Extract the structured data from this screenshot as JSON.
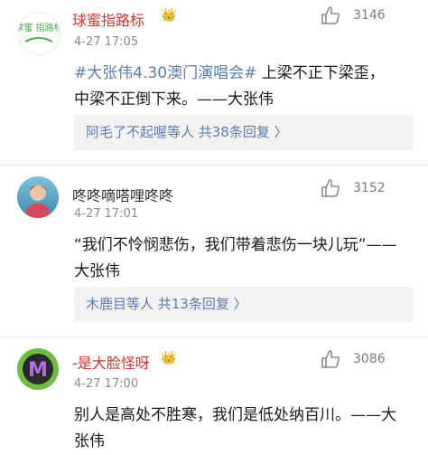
{
  "comments": [
    {
      "username": "球蜜指路标",
      "time": "4-27 17:05",
      "likes": "3146",
      "hashtag": "#大张伟4.30澳门演唱会#",
      "text": " 上梁不正下梁歪，中梁不正倒下来。——大张伟",
      "reply_summary": "阿毛了不起喔等人  共38条回复 〉",
      "avatar_text": "球蜜 指路标"
    },
    {
      "username": "咚咚嘀嗒哩咚咚",
      "time": "4-27 17:01",
      "likes": "3152",
      "text": "“我们不怜悯悲伤，我们带着悲伤一块儿玩”——大张伟",
      "reply_summary": "木鹿目等人  共13条回复 〉"
    },
    {
      "username": "-是大脸怪呀",
      "time": "4-27 17:00",
      "likes": "3086",
      "text": "别人是高处不胜寒，我们是低处纳百川。——大张伟",
      "avatar_text": "M"
    }
  ],
  "colors": {
    "link": "#5b7db1",
    "crown": "#f0a52c",
    "reply_bg": "#f2f2f2"
  }
}
